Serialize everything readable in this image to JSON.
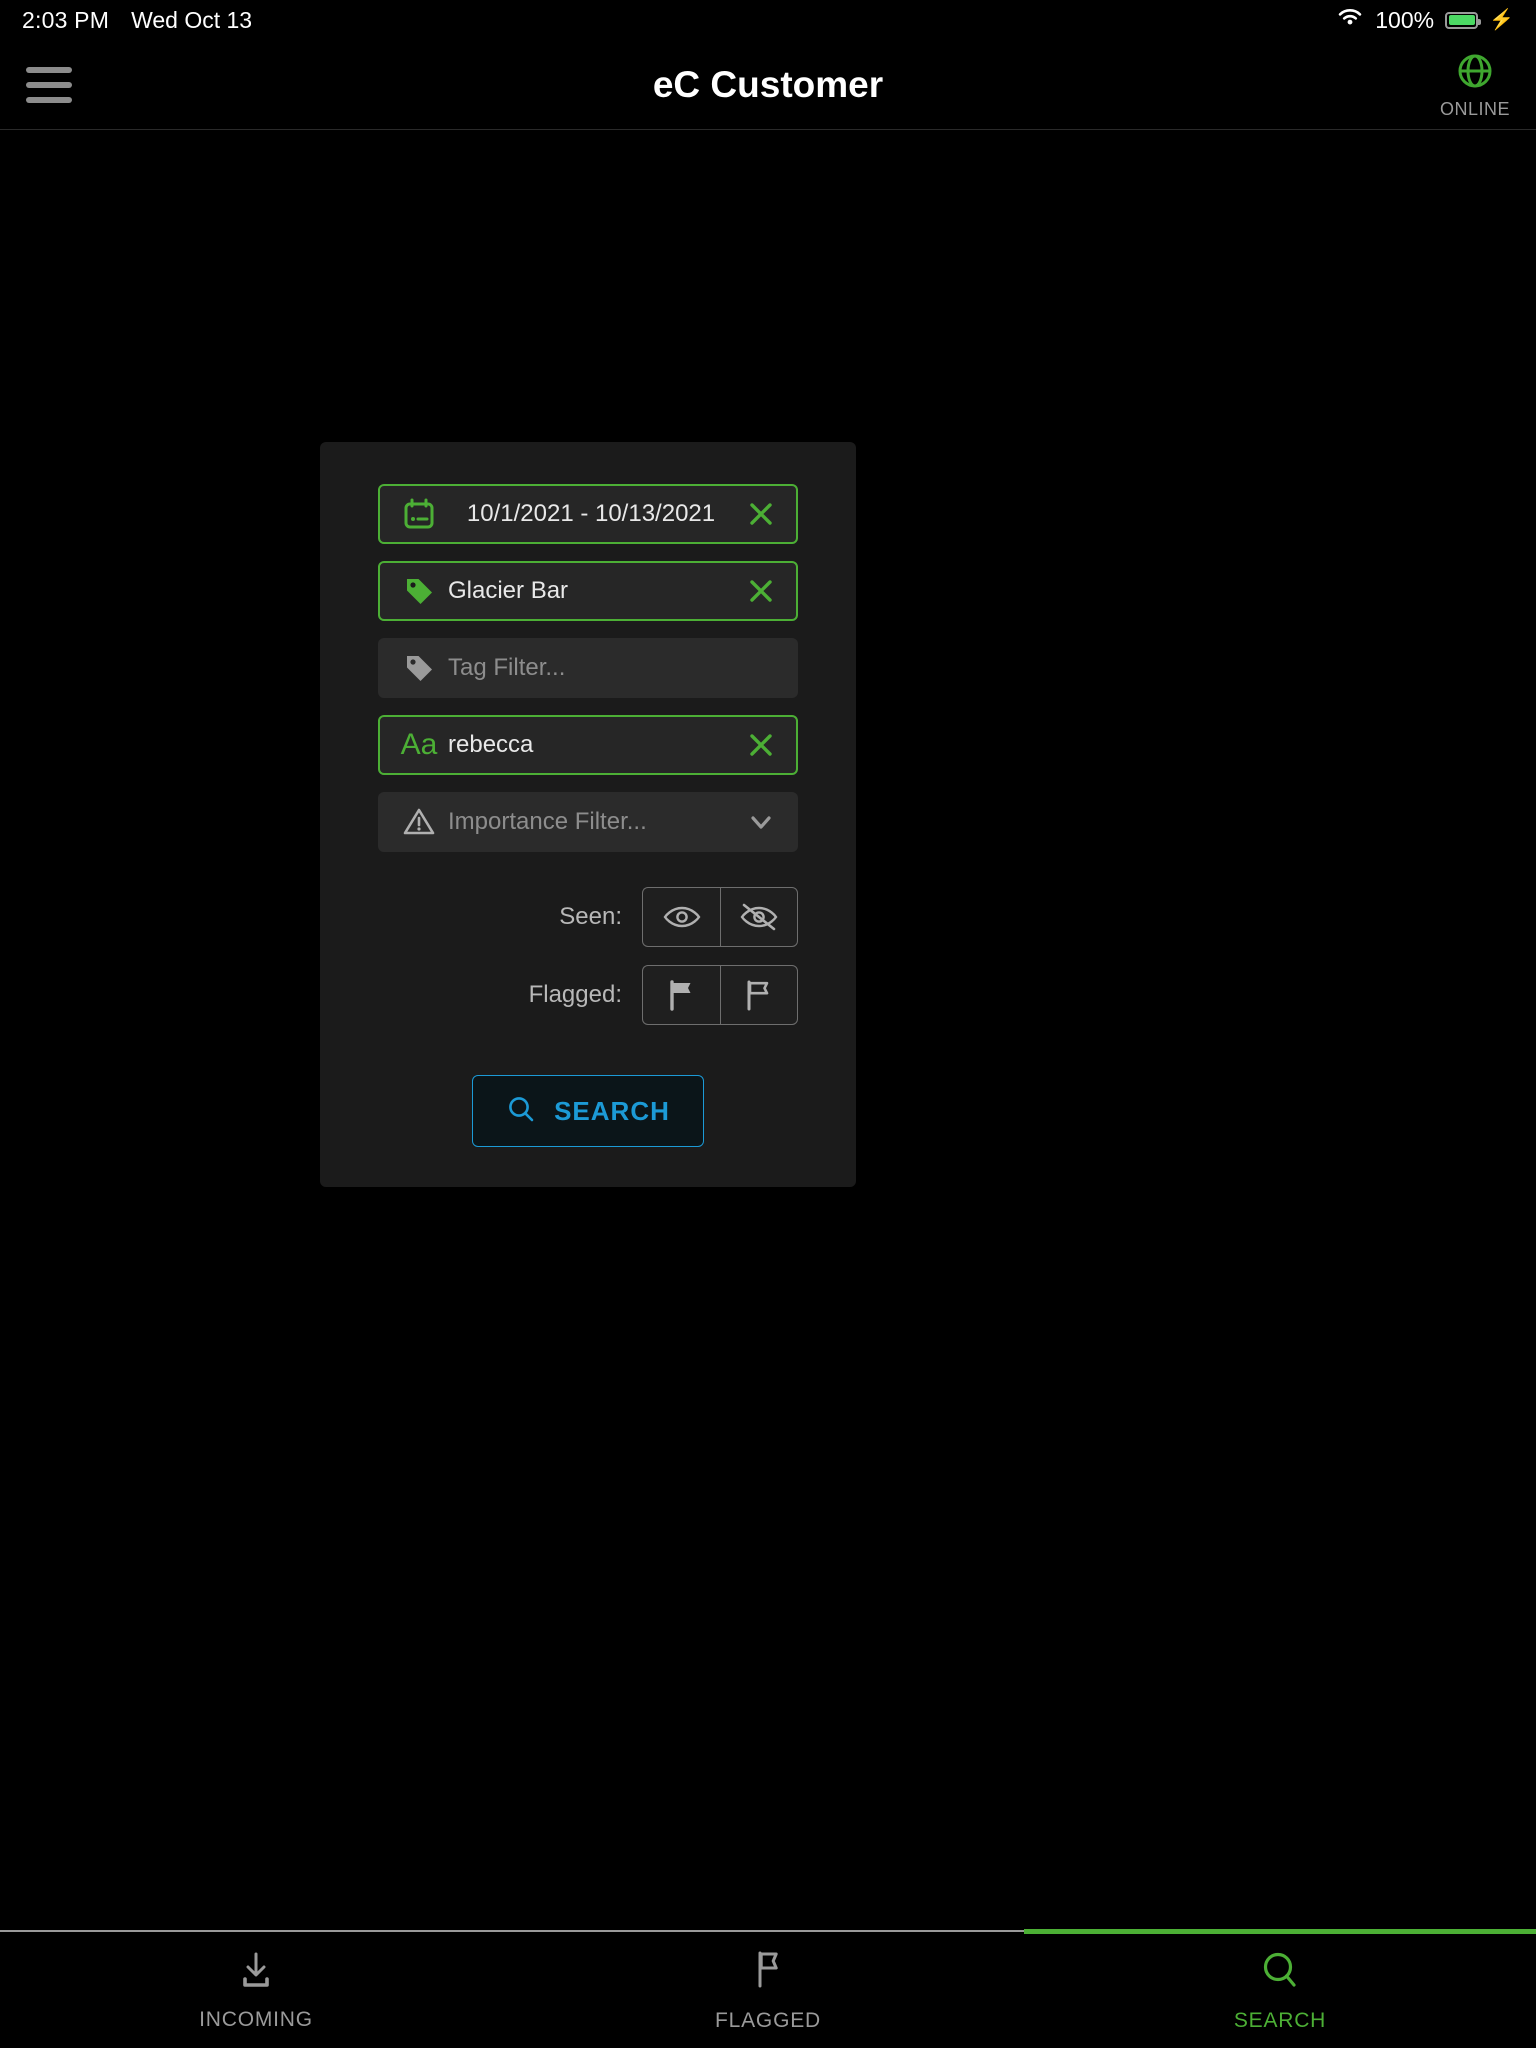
{
  "status_bar": {
    "time": "2:03 PM",
    "date": "Wed Oct 13",
    "battery_percent": "100%",
    "wifi_icon": "wifi-icon",
    "battery_icon": "battery-full-icon",
    "charging_icon": "lightning-bolt-icon"
  },
  "app_bar": {
    "title": "eC Customer",
    "menu_icon": "hamburger-menu-icon",
    "connectivity_icon": "globe-icon",
    "connectivity_label": "ONLINE",
    "online_color": "#3fa72f"
  },
  "filters": {
    "date_range": {
      "icon": "calendar-icon",
      "value": "10/1/2021 - 10/13/2021",
      "clear_label": "×",
      "active": true
    },
    "tag_selected": {
      "icon": "tag-icon",
      "value": "Glacier Bar",
      "clear_label": "×",
      "active": true
    },
    "tag_filter": {
      "icon": "tag-icon",
      "placeholder": "Tag Filter...",
      "active": false
    },
    "text_search": {
      "icon": "text-format-icon",
      "icon_label": "Aa",
      "value": "rebecca",
      "clear_label": "×",
      "active": true
    },
    "importance": {
      "icon": "warning-triangle-icon",
      "placeholder": "Importance Filter...",
      "chevron_icon": "chevron-down-icon",
      "active": false
    },
    "seen": {
      "label": "Seen:",
      "option_seen_icon": "eye-icon",
      "option_unseen_icon": "eye-off-icon"
    },
    "flagged": {
      "label": "Flagged:",
      "option_flagged_icon": "flag-filled-icon",
      "option_unflagged_icon": "flag-outline-icon"
    },
    "search_button": {
      "label": "SEARCH",
      "icon": "search-icon",
      "color": "#1c9ad6"
    }
  },
  "bottom_nav": {
    "items": [
      {
        "label": "INCOMING",
        "icon": "download-inbox-icon",
        "active": false
      },
      {
        "label": "FLAGGED",
        "icon": "flag-outline-icon",
        "active": false
      },
      {
        "label": "SEARCH",
        "icon": "search-icon",
        "active": true
      }
    ],
    "active_color": "#4caf35"
  },
  "theme": {
    "background": "#000000",
    "card_background": "#1b1b1b",
    "field_background": "#262626",
    "accent_green": "#4caf35",
    "accent_blue": "#1c9ad6"
  }
}
